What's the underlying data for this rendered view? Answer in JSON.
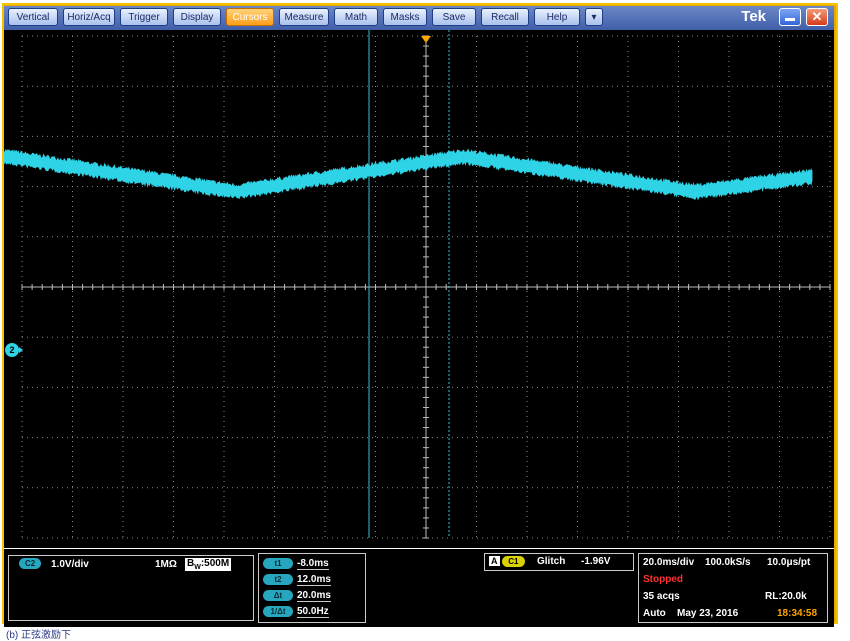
{
  "menu": {
    "items": [
      "Vertical",
      "Horiz/Acq",
      "Trigger",
      "Display",
      "Cursors",
      "Measure",
      "Math",
      "Masks",
      "Save",
      "Recall",
      "Help",
      "▾"
    ],
    "active": "Cursors",
    "brand": "Tek"
  },
  "channel": {
    "badge": "C2",
    "scale": "1.0V/div",
    "impedance": "1MΩ",
    "bw_label": "W",
    "bw_prefix": "B",
    "bw_value": ":500M",
    "marker": "2"
  },
  "cursors": {
    "rows": [
      {
        "badge": "t1",
        "value": "-8.0ms"
      },
      {
        "badge": "t2",
        "value": "12.0ms"
      },
      {
        "badge": "Δt",
        "value": "20.0ms"
      },
      {
        "badge": "1/Δt",
        "value": "50.0Hz"
      }
    ]
  },
  "trigger": {
    "mode_badge": "A",
    "source_badge": "C1",
    "type": "Glitch",
    "level": "-1.96V"
  },
  "acquisition": {
    "timebase": "20.0ms/div",
    "sample_rate": "100.0kS/s",
    "resolution": "10.0μs/pt",
    "state": "Stopped",
    "acqs": "35 acqs",
    "record_length": "RL:20.0k",
    "mode": "Auto",
    "date": "May 23, 2016",
    "time": "18:34:58"
  },
  "caption": "(b) 正弦激励下",
  "colors": {
    "trace": "#2ed3e6",
    "cursor": "#33c4d6",
    "grid": "#8a8a8a",
    "active_menu": "#ff9d1a",
    "stopped": "#ff3030"
  },
  "waveform": {
    "vertices_div": [
      [
        0,
        2.4
      ],
      [
        4.6,
        3.1
      ],
      [
        9.1,
        2.4
      ],
      [
        13.7,
        3.1
      ],
      [
        16,
        2.8
      ]
    ]
  }
}
